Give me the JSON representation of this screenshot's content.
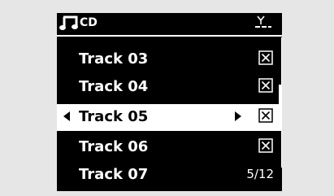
{
  "header": {
    "title": "CD",
    "icons": [
      "music-note-icon",
      "antenna-icon"
    ]
  },
  "tracks": [
    {
      "label": "Track 03",
      "checked": true
    },
    {
      "label": "Track 04",
      "checked": true
    },
    {
      "label": "Track 05",
      "checked": true,
      "selected": true
    },
    {
      "label": "Track 06",
      "checked": true
    },
    {
      "label": "Track 07",
      "checked": false
    }
  ],
  "position": "5/12",
  "colors": {
    "background": "#000000",
    "text": "#ffffff",
    "selected_background": "#ffffff",
    "selected_text": "#000000",
    "frame": "#e6e6e6"
  }
}
